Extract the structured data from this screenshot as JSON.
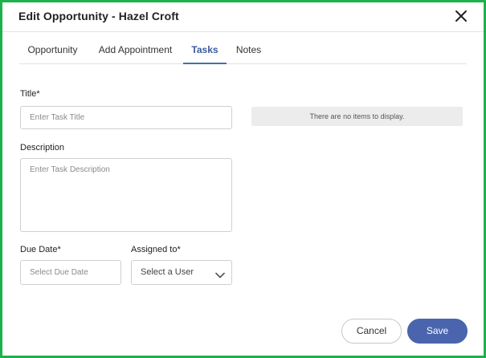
{
  "dialog": {
    "title": "Edit Opportunity - Hazel Croft",
    "close_icon": "close-icon"
  },
  "tabs": [
    {
      "label": "Opportunity",
      "active": false
    },
    {
      "label": "Add Appointment",
      "active": false
    },
    {
      "label": "Tasks",
      "active": true
    },
    {
      "label": "Notes",
      "active": false
    }
  ],
  "form": {
    "title_label": "Title*",
    "title_placeholder": "Enter Task Title",
    "description_label": "Description",
    "description_placeholder": "Enter Task Description",
    "due_date_label": "Due Date*",
    "due_date_placeholder": "Select Due Date",
    "assigned_label": "Assigned to*",
    "assigned_value": "Select a User",
    "assigned_icon": "chevron-down-icon"
  },
  "task_list": {
    "empty_message": "There are no items to display."
  },
  "footer": {
    "cancel_label": "Cancel",
    "save_label": "Save"
  },
  "colors": {
    "frame_border": "#1cb24a",
    "accent": "#4a65ad",
    "active_tab": "#3a5a9c"
  }
}
